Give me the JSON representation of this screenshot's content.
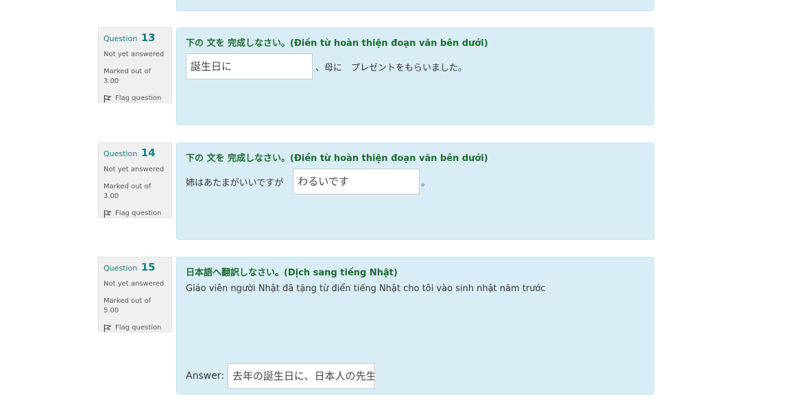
{
  "labels": {
    "question": "Question",
    "flag": "Flag question",
    "answer": "Answer:"
  },
  "questions": [
    {
      "number": "13",
      "state": "Not yet answered",
      "marks": "Marked out of 3.00",
      "prompt": "下の 文を 完成しなさい。(Điền từ hoàn thiện đoạn văn bên dưới)",
      "before": "",
      "input_value": "誕生日に",
      "after": "、母に　プレゼントをもらいました。"
    },
    {
      "number": "14",
      "state": "Not yet answered",
      "marks": "Marked out of 3.00",
      "prompt": "下の 文を 完成しなさい。(Điền từ hoàn thiện đoạn văn bên dưới)",
      "before": "姉はあたまがいいですが",
      "input_value": "わるいです",
      "after": "。"
    },
    {
      "number": "15",
      "state": "Not yet answered",
      "marks": "Marked out of 5.00",
      "prompt": "日本語へ翻訳しなさい。(Dịch sang tiếng Nhật)",
      "sentence": "Giáo viên người Nhật đã tặng từ điển tiếng Nhật cho tôi vào sinh nhật năm trước",
      "answer_value": "去年の誕生日に、日本人の先生"
    }
  ],
  "icons": {
    "flag": "flag-icon"
  },
  "colors": {
    "content_bg": "#d9edf7",
    "prompt_green": "#1b6a2f",
    "qno_teal": "#1a7b80",
    "info_bg": "#f0f0f0"
  }
}
